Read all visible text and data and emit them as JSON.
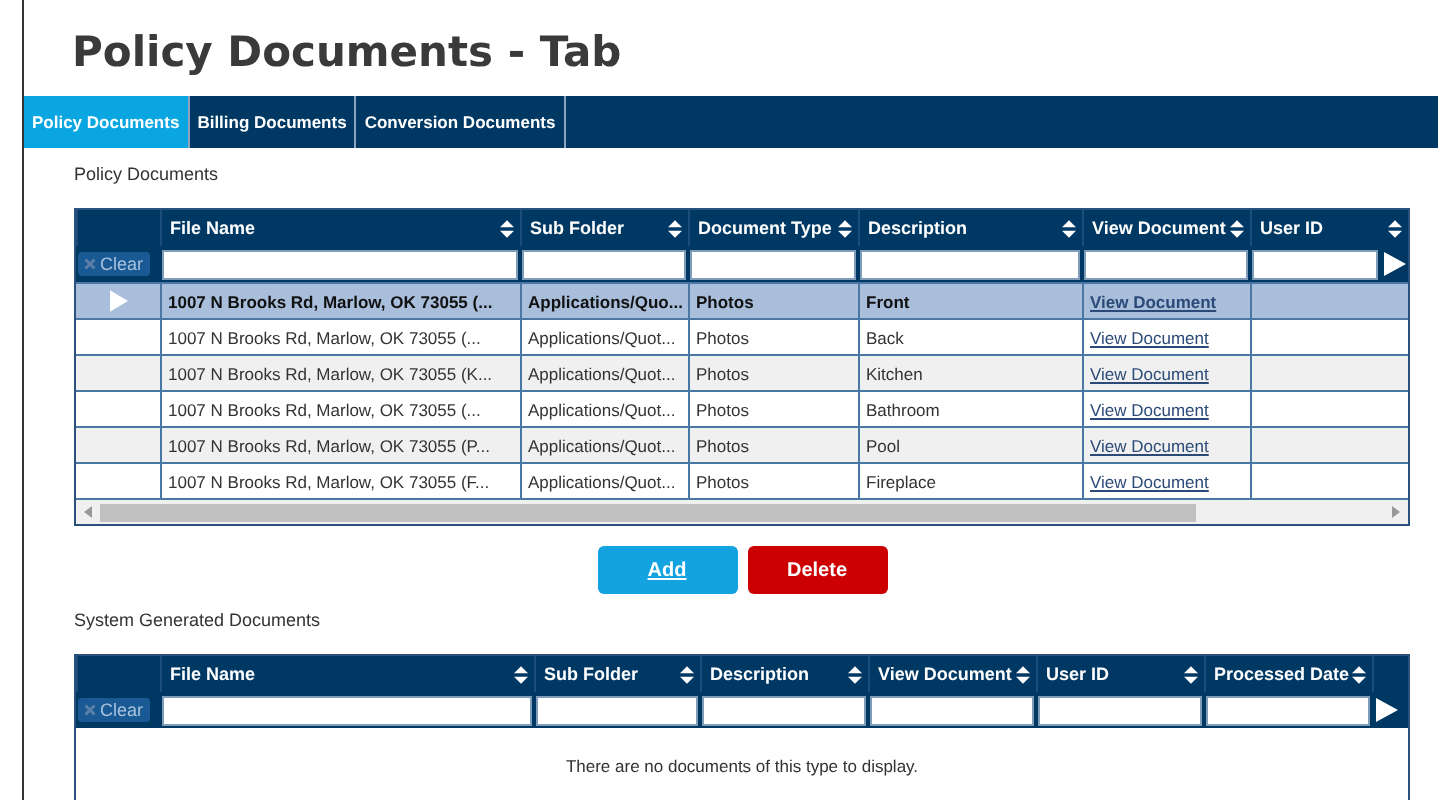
{
  "title": "Policy Documents - Tab",
  "tabs": [
    {
      "label": "Policy Documents",
      "selected": true
    },
    {
      "label": "Billing Documents",
      "selected": false
    },
    {
      "label": "Conversion Documents",
      "selected": false
    }
  ],
  "policy_documents": {
    "heading": "Policy Documents",
    "clear_label": "Clear",
    "columns": [
      "File Name",
      "Sub Folder",
      "Document Type",
      "Description",
      "View Document",
      "User ID"
    ],
    "rows": [
      {
        "file_name": "1007 N Brooks Rd, Marlow, OK 73055 (...",
        "sub_folder": "Applications/Quo...",
        "document_type": "Photos",
        "description": "Front",
        "view_document": "View Document",
        "selected": true
      },
      {
        "file_name": "1007 N Brooks Rd, Marlow, OK 73055 (...",
        "sub_folder": "Applications/Quot...",
        "document_type": "Photos",
        "description": "Back",
        "view_document": "View Document",
        "selected": false
      },
      {
        "file_name": "1007 N Brooks Rd, Marlow, OK 73055 (K...",
        "sub_folder": "Applications/Quot...",
        "document_type": "Photos",
        "description": "Kitchen",
        "view_document": "View Document",
        "selected": false
      },
      {
        "file_name": "1007 N Brooks Rd, Marlow, OK 73055 (...",
        "sub_folder": "Applications/Quot...",
        "document_type": "Photos",
        "description": "Bathroom",
        "view_document": "View Document",
        "selected": false
      },
      {
        "file_name": "1007 N Brooks Rd, Marlow, OK 73055 (P...",
        "sub_folder": "Applications/Quot...",
        "document_type": "Photos",
        "description": "Pool",
        "view_document": "View Document",
        "selected": false
      },
      {
        "file_name": "1007 N Brooks Rd, Marlow, OK 73055 (F...",
        "sub_folder": "Applications/Quot...",
        "document_type": "Photos",
        "description": "Fireplace",
        "view_document": "View Document",
        "selected": false
      }
    ]
  },
  "buttons": [
    {
      "label": "Add",
      "kind": "primary"
    },
    {
      "label": "Delete",
      "kind": "danger"
    }
  ],
  "system_generated_documents": {
    "heading": "System Generated Documents",
    "clear_label": "Clear",
    "columns": [
      "File Name",
      "Sub Folder",
      "Description",
      "View Document",
      "User ID",
      "Processed Date"
    ],
    "empty_message": "There are no documents of this type to display."
  }
}
